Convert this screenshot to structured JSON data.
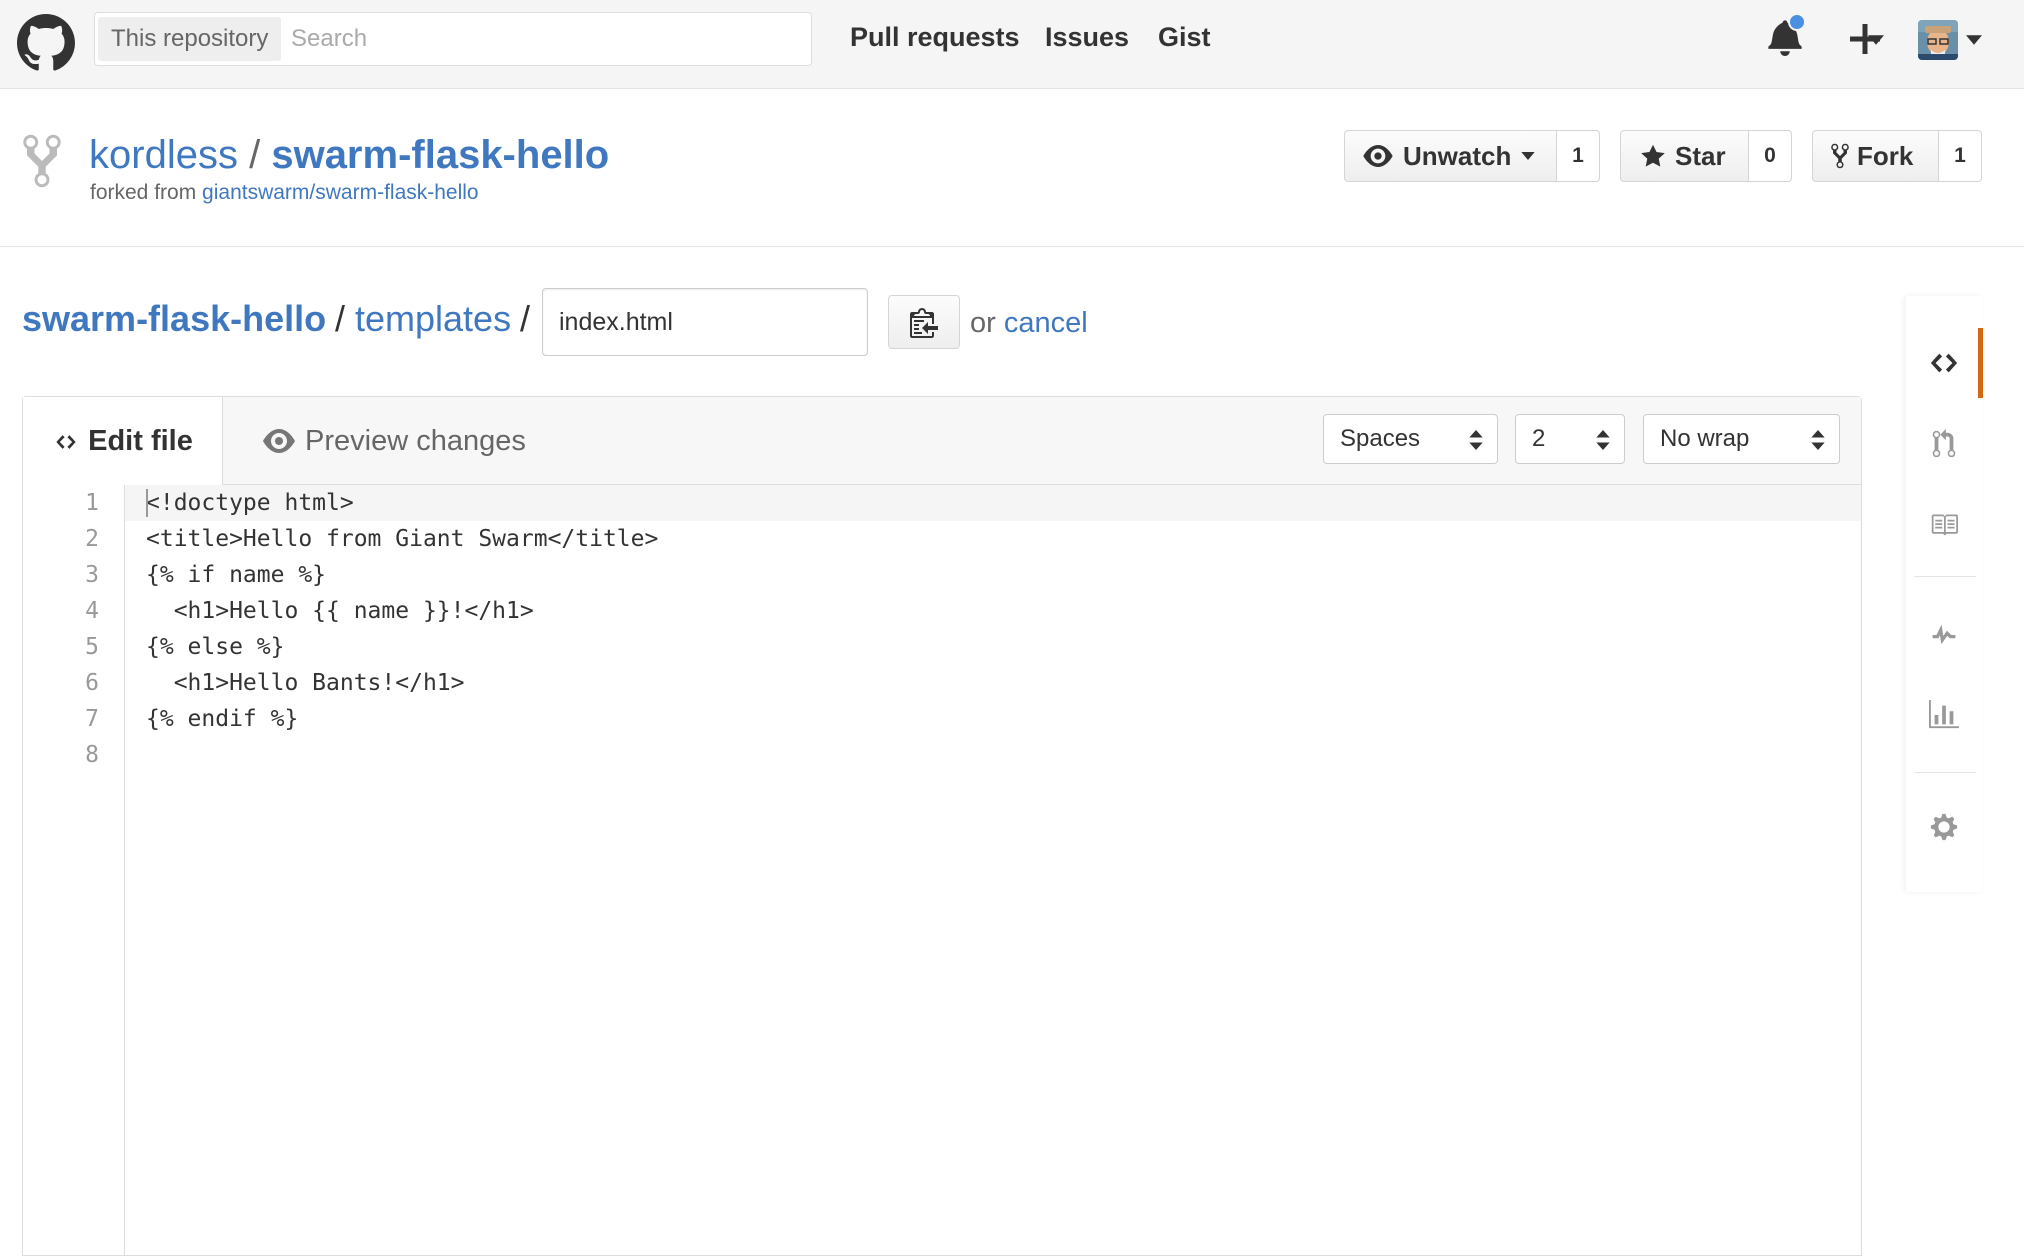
{
  "header": {
    "search_scope": "This repository",
    "search_placeholder": "Search",
    "nav": [
      "Pull requests",
      "Issues",
      "Gist"
    ]
  },
  "repo": {
    "owner": "kordless",
    "separator": "/",
    "name": "swarm-flask-hello",
    "forked_from_label": "forked from",
    "forked_from_link": "giantswarm/swarm-flask-hello",
    "unwatch_label": "Unwatch",
    "unwatch_count": "1",
    "star_label": "Star",
    "star_count": "0",
    "fork_label": "Fork",
    "fork_count": "1"
  },
  "breadcrumb": {
    "repo": "swarm-flask-hello",
    "folder": "templates",
    "sep": "/",
    "filename_value": "index.html",
    "or_text": "or",
    "cancel_label": "cancel"
  },
  "editor": {
    "tab_edit": "Edit file",
    "tab_preview": "Preview changes",
    "indent_mode": "Spaces",
    "indent_size": "2",
    "wrap_mode": "No wrap",
    "line_numbers": [
      "1",
      "2",
      "3",
      "4",
      "5",
      "6",
      "7",
      "8"
    ],
    "lines": [
      "<!doctype html>",
      "<title>Hello from Giant Swarm</title>",
      "{% if name %}",
      "  <h1>Hello {{ name }}!</h1>",
      "{% else %}",
      "  <h1>Hello Bants!</h1>",
      "{% endif %}",
      ""
    ]
  },
  "colors": {
    "link": "#4078c0",
    "active_sidebar": "#d26911",
    "notification_dot": "#4a90e2"
  },
  "icons": {
    "header": [
      "github-logo-icon",
      "bell-icon",
      "plus-icon",
      "caret-down-icon",
      "avatar"
    ],
    "sidebar": [
      "code-icon",
      "pull-request-icon",
      "book-icon",
      "pulse-icon",
      "graph-icon",
      "gear-icon"
    ]
  }
}
